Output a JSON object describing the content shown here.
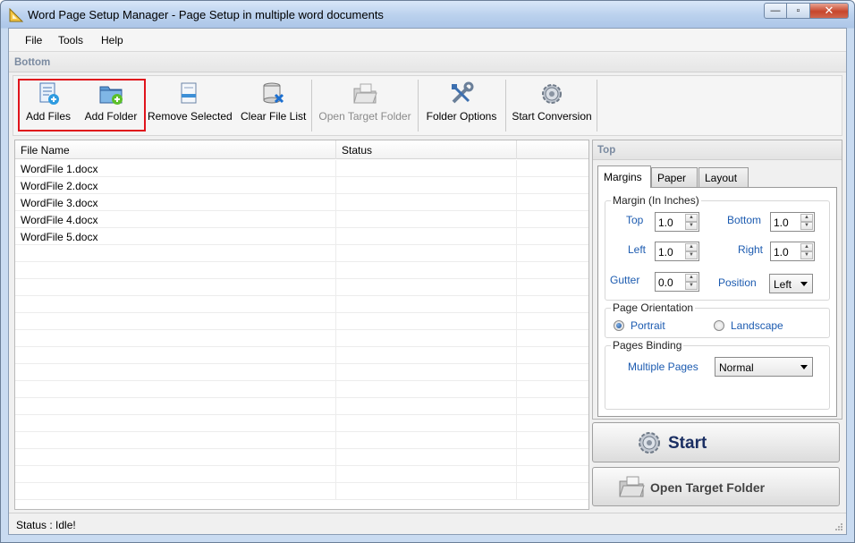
{
  "window": {
    "title": "Word Page Setup Manager - Page Setup in multiple word documents",
    "minimize_glyph": "—",
    "maximize_glyph": "▫",
    "close_glyph": "✕"
  },
  "menu": {
    "items": [
      {
        "label": "File"
      },
      {
        "label": "Tools"
      },
      {
        "label": "Help"
      }
    ]
  },
  "bottom_section_label": "Bottom",
  "toolbar": {
    "buttons": [
      {
        "label": "Add Files",
        "icon": "add-files-icon",
        "enabled": true
      },
      {
        "label": "Add Folder",
        "icon": "add-folder-icon",
        "enabled": true
      },
      {
        "label": "Remove Selected",
        "icon": "remove-selected-icon",
        "enabled": true
      },
      {
        "label": "Clear File List",
        "icon": "clear-list-icon",
        "enabled": true
      },
      {
        "label": "Open Target Folder",
        "icon": "open-folder-icon",
        "enabled": false
      },
      {
        "label": "Folder Options",
        "icon": "folder-options-icon",
        "enabled": true
      },
      {
        "label": "Start Conversion",
        "icon": "gear-icon",
        "enabled": true
      }
    ]
  },
  "file_list": {
    "columns": [
      "File Name",
      "Status",
      ""
    ],
    "rows": [
      {
        "name": "WordFile 1.docx",
        "status": ""
      },
      {
        "name": "WordFile 2.docx",
        "status": ""
      },
      {
        "name": "WordFile 3.docx",
        "status": ""
      },
      {
        "name": "WordFile 4.docx",
        "status": ""
      },
      {
        "name": "WordFile 5.docx",
        "status": ""
      }
    ]
  },
  "top_panel": {
    "title": "Top",
    "tabs": [
      {
        "label": "Margins",
        "active": true
      },
      {
        "label": "Paper",
        "active": false
      },
      {
        "label": "Layout",
        "active": false
      }
    ],
    "margins_group": {
      "title": "Margin (In Inches)",
      "top_label": "Top",
      "top_value": "1.0",
      "bottom_label": "Bottom",
      "bottom_value": "1.0",
      "left_label": "Left",
      "left_value": "1.0",
      "right_label": "Right",
      "right_value": "1.0",
      "gutter_label": "Gutter",
      "gutter_value": "0.0",
      "position_label": "Position",
      "position_value": "Left"
    },
    "orientation_group": {
      "title": "Page Orientation",
      "portrait_label": "Portrait",
      "landscape_label": "Landscape",
      "selected": "Portrait"
    },
    "binding_group": {
      "title": "Pages Binding",
      "multiple_pages_label": "Multiple Pages",
      "multiple_pages_value": "Normal"
    }
  },
  "actions": {
    "start_label": "Start",
    "open_target_label": "Open Target Folder"
  },
  "status": {
    "text": "Status  :  Idle!"
  },
  "colors": {
    "highlight_border": "#e0141c",
    "label_blue": "#1c5bb0",
    "start_text": "#1b2f63"
  }
}
